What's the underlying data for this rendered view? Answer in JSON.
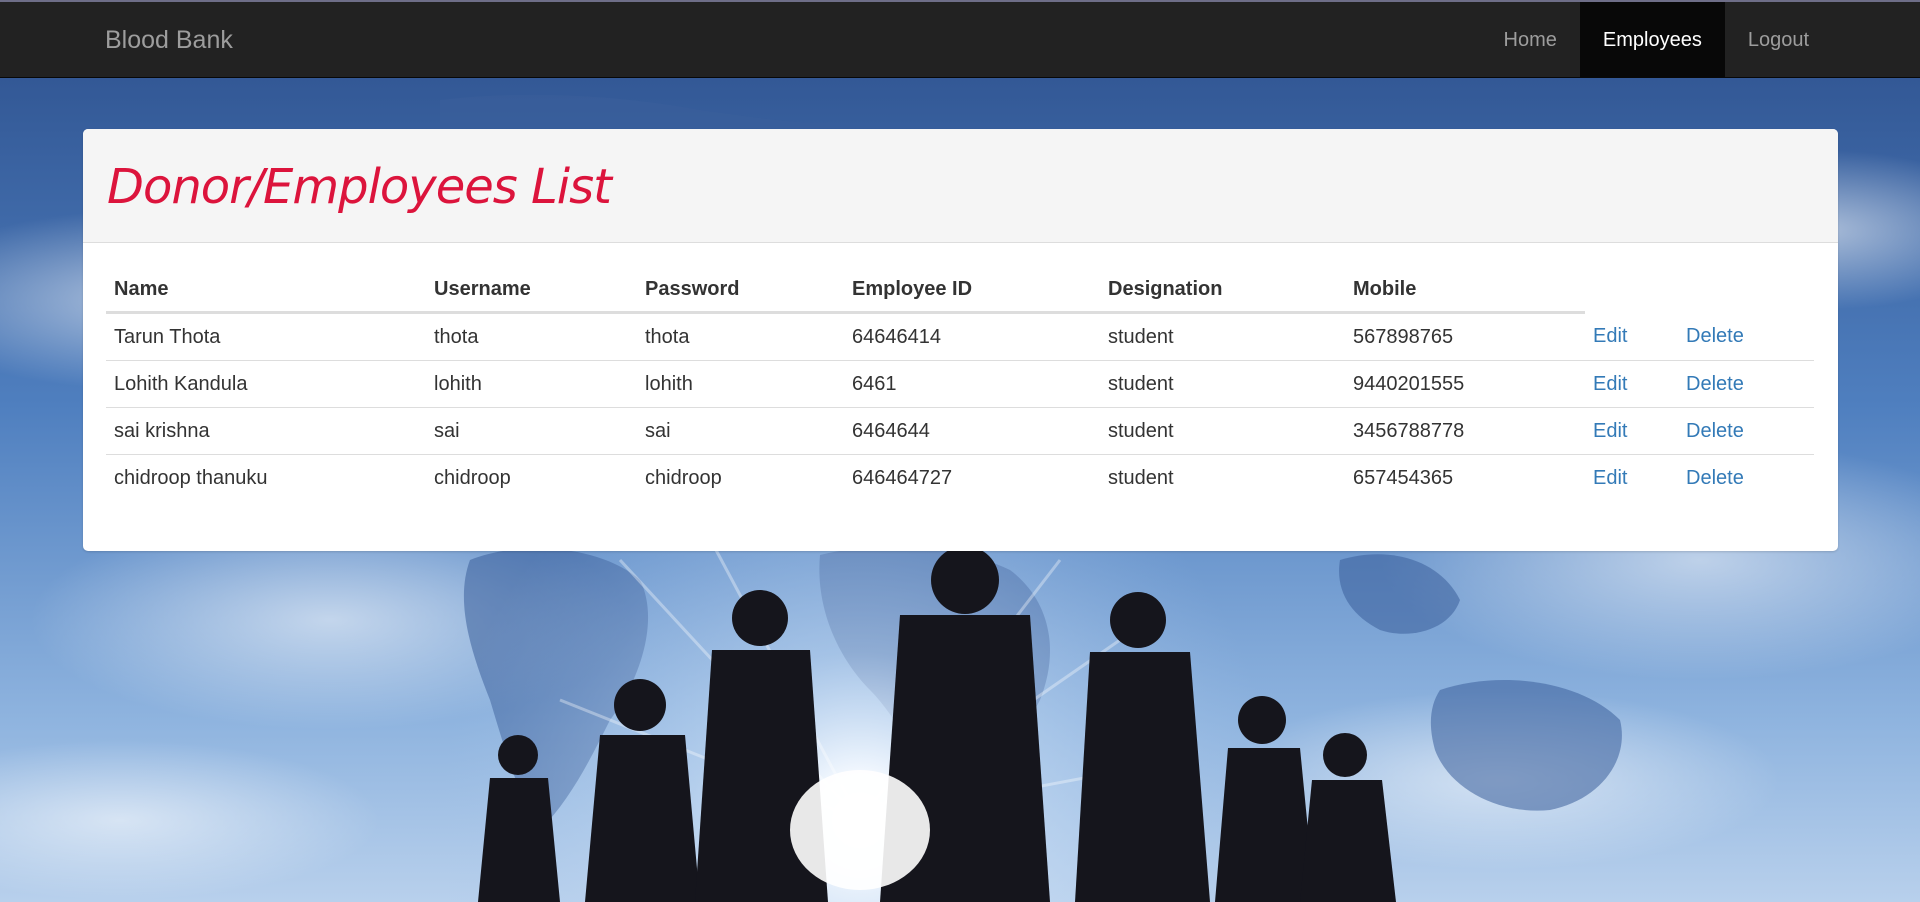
{
  "navbar": {
    "brand": "Blood Bank",
    "links": [
      {
        "label": "Home",
        "active": false
      },
      {
        "label": "Employees",
        "active": true
      },
      {
        "label": "Logout",
        "active": false
      }
    ]
  },
  "panel": {
    "title": "Donor/Employees List"
  },
  "table": {
    "headers": [
      "Name",
      "Username",
      "Password",
      "Employee ID",
      "Designation",
      "Mobile"
    ],
    "action_labels": {
      "edit": "Edit",
      "delete": "Delete"
    },
    "rows": [
      {
        "name": "Tarun Thota",
        "username": "thota",
        "password": "thota",
        "employee_id": "64646414",
        "designation": "student",
        "mobile": "567898765"
      },
      {
        "name": "Lohith Kandula",
        "username": "lohith",
        "password": "lohith",
        "employee_id": "6461",
        "designation": "student",
        "mobile": "9440201555"
      },
      {
        "name": "sai krishna",
        "username": "sai",
        "password": "sai",
        "employee_id": "6464644",
        "designation": "student",
        "mobile": "3456788778"
      },
      {
        "name": "chidroop thanuku",
        "username": "chidroop",
        "password": "chidroop",
        "employee_id": "646464727",
        "designation": "student",
        "mobile": "657454365"
      }
    ]
  },
  "colors": {
    "navbar_bg": "#222222",
    "nav_active_bg": "#080808",
    "title_color": "#dc143c",
    "link_color": "#337ab7"
  }
}
